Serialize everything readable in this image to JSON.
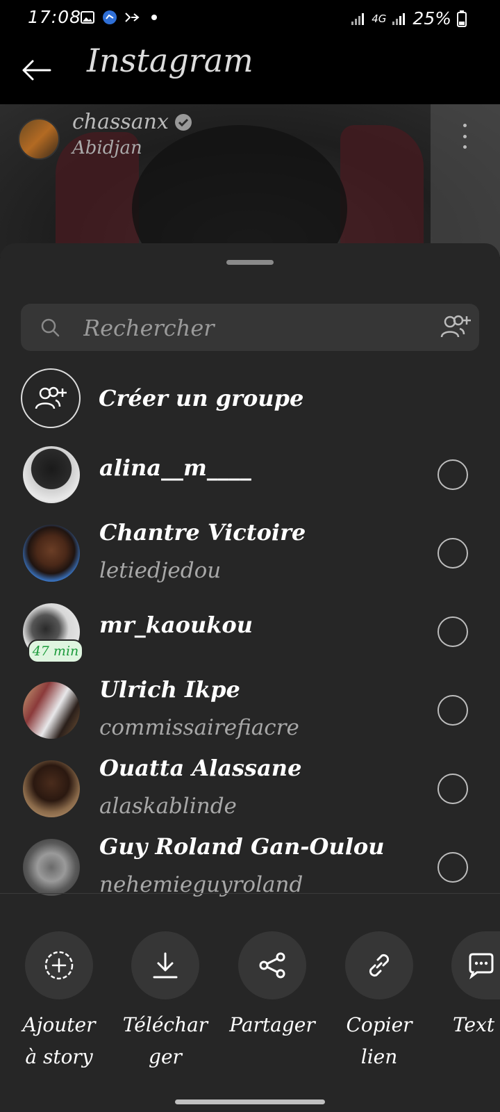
{
  "status": {
    "time": "17:08",
    "network": "4G",
    "battery": "25%"
  },
  "app": {
    "title": "Instagram"
  },
  "post": {
    "username": "chassanx",
    "location": "Abidjan"
  },
  "sheet": {
    "search_placeholder": "Rechercher",
    "create_group": "Créer un groupe",
    "contacts": [
      {
        "name": "alina__m____",
        "username": ""
      },
      {
        "name": "Chantre Victoire",
        "username": "letiedjedou"
      },
      {
        "name": "mr_kaoukou",
        "username": "",
        "badge": "47 min"
      },
      {
        "name": "Ulrich Ikpe",
        "username": "commissairefiacre"
      },
      {
        "name": "Ouatta Alassane",
        "username": "alaskablinde"
      },
      {
        "name": "Guy Roland Gan-Oulou",
        "username": "nehemieguyroland"
      }
    ],
    "actions": [
      {
        "line1": "Ajouter",
        "line2": "à story",
        "icon": "add-story-icon"
      },
      {
        "line1": "Téléchar",
        "line2": "ger",
        "icon": "download-icon"
      },
      {
        "line1": "Partager",
        "line2": "",
        "icon": "share-icon"
      },
      {
        "line1": "Copier",
        "line2": "lien",
        "icon": "link-icon"
      },
      {
        "line1": "Text",
        "line2": "",
        "icon": "message-icon"
      }
    ]
  },
  "colors": {
    "sheet_bg": "#262626",
    "search_bg": "#363636",
    "badge_bg": "#dff5e0",
    "badge_text": "#1a9a3a"
  }
}
